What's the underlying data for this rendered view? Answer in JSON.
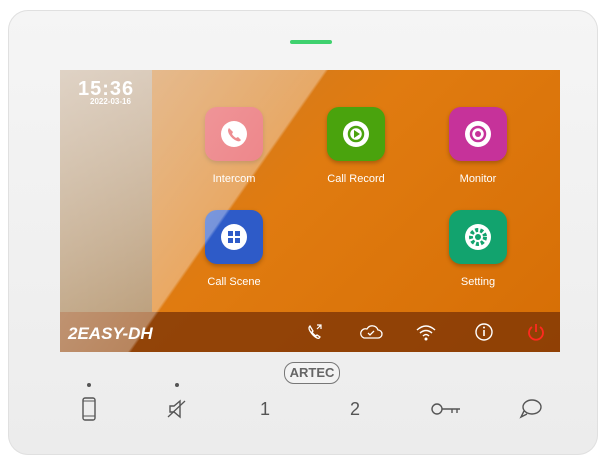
{
  "status": {
    "time": "15:36",
    "date": "2022-03-16"
  },
  "apps": [
    {
      "label": "Intercom",
      "icon": "phone-icon",
      "color": "#e4474d"
    },
    {
      "label": "Call Record",
      "icon": "play-record-icon",
      "color": "#4aa30d"
    },
    {
      "label": "Monitor",
      "icon": "eye-icon",
      "color": "#c6329a"
    },
    {
      "label": "Call Scene",
      "icon": "grid-icon",
      "color": "#2e5bc8"
    },
    {
      "label": "Setting",
      "icon": "gear-icon",
      "color": "#12a36e"
    }
  ],
  "bottom_bar": {
    "model": "2EASY-DH",
    "icons": [
      "call-transfer-icon",
      "cloud-check-icon",
      "wifi-icon",
      "info-icon",
      "power-icon"
    ],
    "power_color": "#ff2a1f"
  },
  "device": {
    "brand_logo": "ARTEC",
    "buttons": [
      {
        "icon": "mobile-icon"
      },
      {
        "icon": "mute-speaker-icon"
      },
      {
        "label": "1"
      },
      {
        "label": "2"
      },
      {
        "icon": "key-icon"
      },
      {
        "icon": "chat-icon"
      }
    ],
    "led_color": "#3fd16e"
  }
}
